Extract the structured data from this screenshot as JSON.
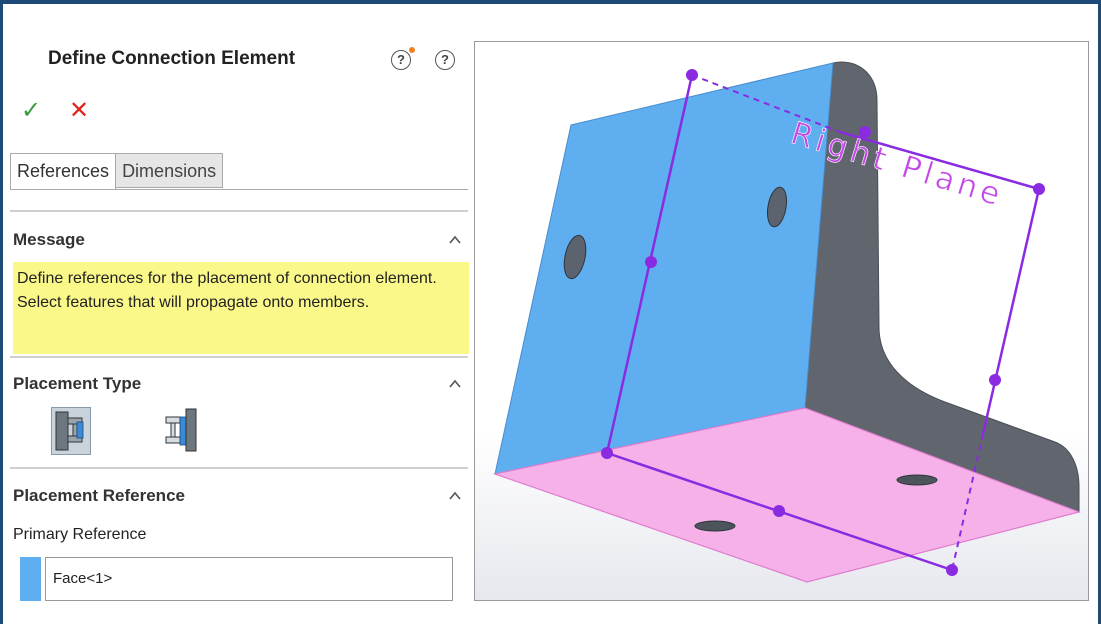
{
  "property_manager": {
    "title": "Define Connection Element",
    "icons": {
      "whats_new": "whats-new-help-icon",
      "help": "help-icon",
      "ok": "checkmark-icon",
      "cancel": "close-icon"
    },
    "help_glyph": "?",
    "ok_glyph": "✓",
    "cancel_glyph": "✕",
    "tabs": [
      {
        "label": "References",
        "active": true
      },
      {
        "label": "Dimensions",
        "active": false
      }
    ],
    "message": {
      "title": "Message",
      "text": "Define references for the placement of connection element. Select features that will propagate onto members."
    },
    "placement_type": {
      "title": "Placement Type",
      "options": [
        "placement-type-a-icon",
        "placement-type-b-icon"
      ]
    },
    "placement_reference": {
      "title": "Placement Reference",
      "primary_label": "Primary Reference",
      "primary_value": "Face<1>"
    }
  },
  "viewport": {
    "plane_label": "Right Plane"
  },
  "colors": {
    "frame": "#1e4a78",
    "message_bg": "#fbf88a",
    "face_blue": "#5faef0",
    "face_pink": "#f6b2e8",
    "side_grey": "#61666e",
    "plane_purple": "#8a2be2",
    "ok_green": "#3a9a3a",
    "cancel_red": "#e0251b"
  }
}
